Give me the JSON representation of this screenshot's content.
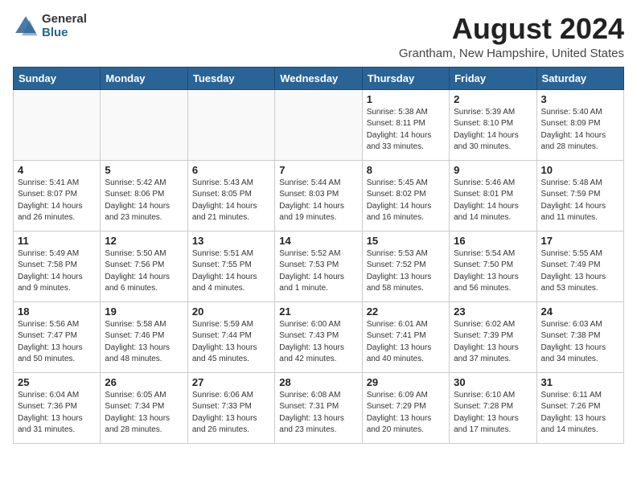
{
  "logo": {
    "general": "General",
    "blue": "Blue"
  },
  "title": "August 2024",
  "location": "Grantham, New Hampshire, United States",
  "headers": [
    "Sunday",
    "Monday",
    "Tuesday",
    "Wednesday",
    "Thursday",
    "Friday",
    "Saturday"
  ],
  "weeks": [
    [
      {
        "day": "",
        "detail": ""
      },
      {
        "day": "",
        "detail": ""
      },
      {
        "day": "",
        "detail": ""
      },
      {
        "day": "",
        "detail": ""
      },
      {
        "day": "1",
        "detail": "Sunrise: 5:38 AM\nSunset: 8:11 PM\nDaylight: 14 hours\nand 33 minutes."
      },
      {
        "day": "2",
        "detail": "Sunrise: 5:39 AM\nSunset: 8:10 PM\nDaylight: 14 hours\nand 30 minutes."
      },
      {
        "day": "3",
        "detail": "Sunrise: 5:40 AM\nSunset: 8:09 PM\nDaylight: 14 hours\nand 28 minutes."
      }
    ],
    [
      {
        "day": "4",
        "detail": "Sunrise: 5:41 AM\nSunset: 8:07 PM\nDaylight: 14 hours\nand 26 minutes."
      },
      {
        "day": "5",
        "detail": "Sunrise: 5:42 AM\nSunset: 8:06 PM\nDaylight: 14 hours\nand 23 minutes."
      },
      {
        "day": "6",
        "detail": "Sunrise: 5:43 AM\nSunset: 8:05 PM\nDaylight: 14 hours\nand 21 minutes."
      },
      {
        "day": "7",
        "detail": "Sunrise: 5:44 AM\nSunset: 8:03 PM\nDaylight: 14 hours\nand 19 minutes."
      },
      {
        "day": "8",
        "detail": "Sunrise: 5:45 AM\nSunset: 8:02 PM\nDaylight: 14 hours\nand 16 minutes."
      },
      {
        "day": "9",
        "detail": "Sunrise: 5:46 AM\nSunset: 8:01 PM\nDaylight: 14 hours\nand 14 minutes."
      },
      {
        "day": "10",
        "detail": "Sunrise: 5:48 AM\nSunset: 7:59 PM\nDaylight: 14 hours\nand 11 minutes."
      }
    ],
    [
      {
        "day": "11",
        "detail": "Sunrise: 5:49 AM\nSunset: 7:58 PM\nDaylight: 14 hours\nand 9 minutes."
      },
      {
        "day": "12",
        "detail": "Sunrise: 5:50 AM\nSunset: 7:56 PM\nDaylight: 14 hours\nand 6 minutes."
      },
      {
        "day": "13",
        "detail": "Sunrise: 5:51 AM\nSunset: 7:55 PM\nDaylight: 14 hours\nand 4 minutes."
      },
      {
        "day": "14",
        "detail": "Sunrise: 5:52 AM\nSunset: 7:53 PM\nDaylight: 14 hours\nand 1 minute."
      },
      {
        "day": "15",
        "detail": "Sunrise: 5:53 AM\nSunset: 7:52 PM\nDaylight: 13 hours\nand 58 minutes."
      },
      {
        "day": "16",
        "detail": "Sunrise: 5:54 AM\nSunset: 7:50 PM\nDaylight: 13 hours\nand 56 minutes."
      },
      {
        "day": "17",
        "detail": "Sunrise: 5:55 AM\nSunset: 7:49 PM\nDaylight: 13 hours\nand 53 minutes."
      }
    ],
    [
      {
        "day": "18",
        "detail": "Sunrise: 5:56 AM\nSunset: 7:47 PM\nDaylight: 13 hours\nand 50 minutes."
      },
      {
        "day": "19",
        "detail": "Sunrise: 5:58 AM\nSunset: 7:46 PM\nDaylight: 13 hours\nand 48 minutes."
      },
      {
        "day": "20",
        "detail": "Sunrise: 5:59 AM\nSunset: 7:44 PM\nDaylight: 13 hours\nand 45 minutes."
      },
      {
        "day": "21",
        "detail": "Sunrise: 6:00 AM\nSunset: 7:43 PM\nDaylight: 13 hours\nand 42 minutes."
      },
      {
        "day": "22",
        "detail": "Sunrise: 6:01 AM\nSunset: 7:41 PM\nDaylight: 13 hours\nand 40 minutes."
      },
      {
        "day": "23",
        "detail": "Sunrise: 6:02 AM\nSunset: 7:39 PM\nDaylight: 13 hours\nand 37 minutes."
      },
      {
        "day": "24",
        "detail": "Sunrise: 6:03 AM\nSunset: 7:38 PM\nDaylight: 13 hours\nand 34 minutes."
      }
    ],
    [
      {
        "day": "25",
        "detail": "Sunrise: 6:04 AM\nSunset: 7:36 PM\nDaylight: 13 hours\nand 31 minutes."
      },
      {
        "day": "26",
        "detail": "Sunrise: 6:05 AM\nSunset: 7:34 PM\nDaylight: 13 hours\nand 28 minutes."
      },
      {
        "day": "27",
        "detail": "Sunrise: 6:06 AM\nSunset: 7:33 PM\nDaylight: 13 hours\nand 26 minutes."
      },
      {
        "day": "28",
        "detail": "Sunrise: 6:08 AM\nSunset: 7:31 PM\nDaylight: 13 hours\nand 23 minutes."
      },
      {
        "day": "29",
        "detail": "Sunrise: 6:09 AM\nSunset: 7:29 PM\nDaylight: 13 hours\nand 20 minutes."
      },
      {
        "day": "30",
        "detail": "Sunrise: 6:10 AM\nSunset: 7:28 PM\nDaylight: 13 hours\nand 17 minutes."
      },
      {
        "day": "31",
        "detail": "Sunrise: 6:11 AM\nSunset: 7:26 PM\nDaylight: 13 hours\nand 14 minutes."
      }
    ]
  ]
}
